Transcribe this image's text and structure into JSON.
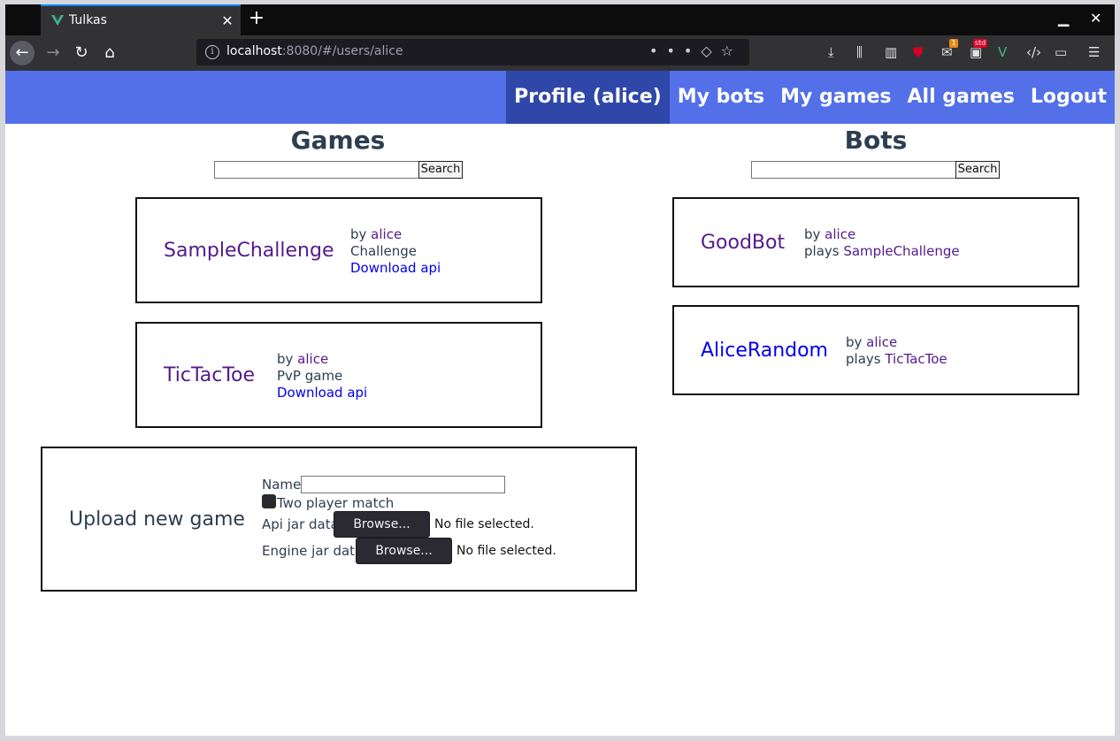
{
  "browser": {
    "tab_title": "Tulkas",
    "url_host": "localhost",
    "url_rest": ":8080/#/users/alice",
    "badges": {
      "notifications": "1",
      "extension": "std"
    }
  },
  "nav": {
    "items": [
      {
        "label": "Profile (alice)",
        "active": true
      },
      {
        "label": "My bots",
        "active": false
      },
      {
        "label": "My games",
        "active": false
      },
      {
        "label": "All games",
        "active": false
      },
      {
        "label": "Logout",
        "active": false
      }
    ]
  },
  "games": {
    "title": "Games",
    "search_label": "Search",
    "items": [
      {
        "name": "SampleChallenge",
        "by": "by ",
        "author": "alice",
        "type": "Challenge",
        "download": "Download api"
      },
      {
        "name": "TicTacToe",
        "by": "by ",
        "author": "alice",
        "type": "PvP game",
        "download": "Download api"
      }
    ]
  },
  "bots": {
    "title": "Bots",
    "search_label": "Search",
    "items": [
      {
        "name": "GoodBot",
        "by": "by ",
        "author": "alice",
        "plays": "plays ",
        "game": "SampleChallenge"
      },
      {
        "name": "AliceRandom",
        "by": "by ",
        "author": "alice",
        "plays": "plays ",
        "game": "TicTacToe"
      }
    ]
  },
  "upload": {
    "title": "Upload new game",
    "name_label": "Name",
    "checkbox_label": "Two player match",
    "api_label": "Api jar data",
    "engine_label": "Engine jar data",
    "browse_label": "Browse...",
    "no_file": "No file selected."
  },
  "colors": {
    "appbar": "#5370e8",
    "appbar_active": "#2f47a8",
    "heading": "#2c3e50",
    "link_visited": "#551a8b",
    "link": "#0000ee"
  }
}
